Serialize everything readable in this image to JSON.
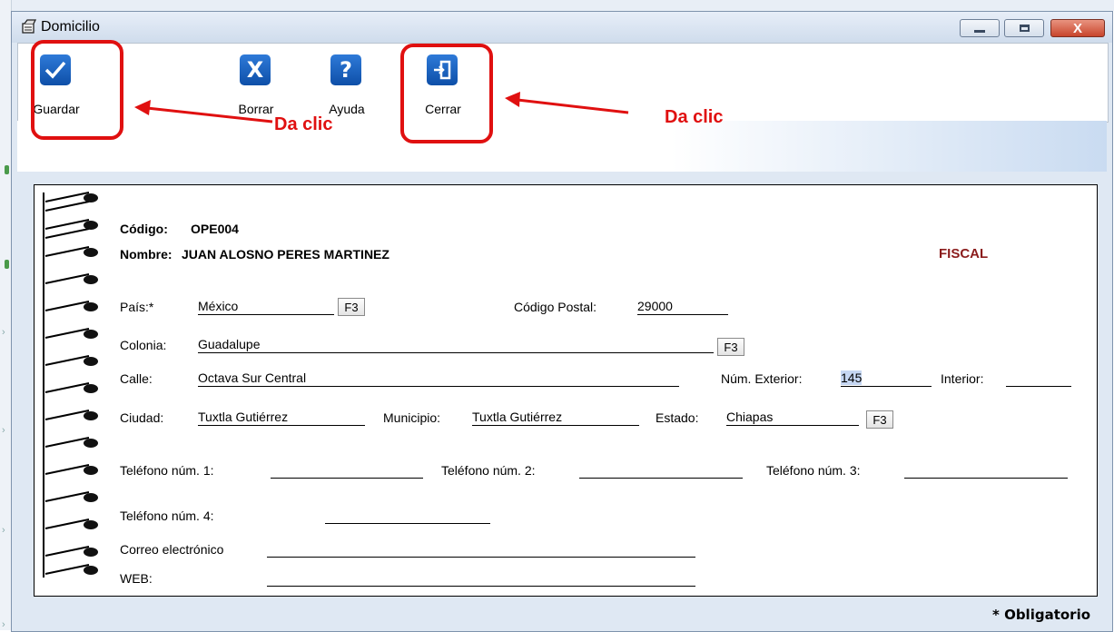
{
  "window": {
    "title": "Domicilio",
    "close_glyph": "X"
  },
  "toolbar": {
    "save": {
      "label": "Guardar",
      "icon": "check-icon"
    },
    "clear": {
      "label": "Borrar",
      "icon": "x-icon",
      "glyph": "X"
    },
    "help": {
      "label": "Ayuda",
      "icon": "question-icon",
      "glyph": "?"
    },
    "close": {
      "label": "Cerrar",
      "icon": "exit-door-icon"
    }
  },
  "record": {
    "codigo_label": "Código:",
    "codigo_value": "OPE004",
    "nombre_label": "Nombre:",
    "nombre_value": "JUAN ALOSNO PERES MARTINEZ",
    "tipo": "FISCAL"
  },
  "form": {
    "pais_label": "País:*",
    "pais_value": "México",
    "f3_label": "F3",
    "cp_label": "Código Postal:",
    "cp_value": "29000",
    "colonia_label": "Colonia:",
    "colonia_value": "Guadalupe",
    "calle_label": "Calle:",
    "calle_value": "Octava Sur Central",
    "num_ext_label": "Núm. Exterior:",
    "num_ext_value": "145",
    "interior_label": "Interior:",
    "interior_value": "",
    "ciudad_label": "Ciudad:",
    "ciudad_value": "Tuxtla Gutiérrez",
    "municipio_label": "Municipio:",
    "municipio_value": "Tuxtla Gutiérrez",
    "estado_label": "Estado:",
    "estado_value": "Chiapas",
    "tel1_label": "Teléfono núm. 1:",
    "tel2_label": "Teléfono núm. 2:",
    "tel3_label": "Teléfono núm. 3:",
    "tel4_label": "Teléfono núm. 4:",
    "correo_label": "Correo electrónico",
    "web_label": "WEB:"
  },
  "footer": {
    "required_note": "* Obligatorio"
  },
  "annotations": {
    "hint_save": "Da clic",
    "hint_close": "Da clic",
    "color": "#e01010"
  },
  "colors": {
    "accent_blue": "#0e4fa8",
    "fiscal_red": "#8b1c1c",
    "selection": "#c5d6f2"
  }
}
